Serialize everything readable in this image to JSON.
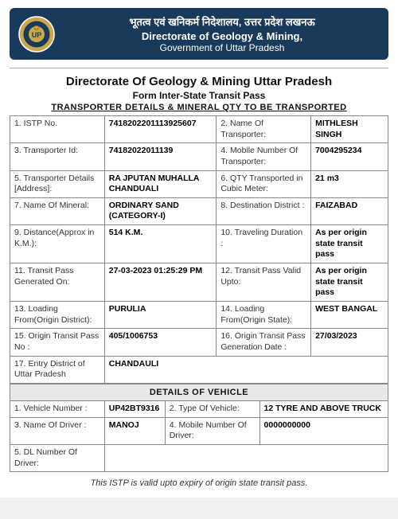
{
  "header": {
    "hindi_title": "भूतत्व एवं खनिकर्म निदेशालय, उत्तर प्रदेश लखनऊ",
    "eng_line1": "Directorate of Geology & Mining,",
    "eng_line2": "Government of Uttar Pradesh"
  },
  "main_title": "Directorate Of Geology & Mining Uttar Pradesh",
  "form_title": "Form Inter-State Transit Pass",
  "section_heading": "Transporter Details & Mineral QTY to be Transported",
  "rows": [
    {
      "col1_label": "1. ISTP No.",
      "col1_value": "7418202201113925607",
      "col2_label": "2. Name Of Transporter:",
      "col2_value": "MITHLESH SINGH"
    },
    {
      "col1_label": "3. Transporter Id:",
      "col1_value": "74182022011139",
      "col2_label": "4. Mobile Number Of Transporter:",
      "col2_value": "7004295234"
    },
    {
      "col1_label": "5. Transporter Details [Address]:",
      "col1_value": "RA JPUTAN MUHALLA CHANDUALI",
      "col2_label": "6. QTY Transported in Cubic Meter:",
      "col2_value": "21 m3"
    },
    {
      "col1_label": "7. Name Of Mineral:",
      "col1_value": "ORDINARY SAND (CATEGORY-I)",
      "col2_label": "8. Destination District :",
      "col2_value": "FAIZABAD"
    },
    {
      "col1_label": "9. Distance(Approx in K.M.):",
      "col1_value": "514 K.M.",
      "col2_label": "10. Traveling Duration :",
      "col2_value": "As per origin state transit pass"
    },
    {
      "col1_label": "11. Transit Pass Generated On:",
      "col1_value": "27-03-2023 01:25:29 PM",
      "col2_label": "12. Transit Pass Valid Upto:",
      "col2_value": "As per origin state transit pass"
    },
    {
      "col1_label": "13. Loading From(Origin District):",
      "col1_value": "PURULIA",
      "col2_label": "14. Loading From(Origin State):",
      "col2_value": "WEST BANGAL"
    },
    {
      "col1_label": "15. Origin Transit Pass No :",
      "col1_value": "405/1006753",
      "col2_label": "16. Origin Transit Pass Generation Date :",
      "col2_value": "27/03/2023"
    },
    {
      "col1_label": "17. Entry District of Uttar Pradesh",
      "col1_value": "CHANDAULI",
      "col2_label": "",
      "col2_value": ""
    }
  ],
  "vehicle_section": "Details Of Vehicle",
  "vehicle_rows": [
    {
      "col1_label": "1. Vehicle Number :",
      "col1_value": "UP42BT9316",
      "col2_label": "2. Type Of Vehicle:",
      "col2_value": "12 TYRE AND ABOVE TRUCK"
    },
    {
      "col1_label": "3. Name Of Driver :",
      "col1_value": "MANOJ",
      "col2_label": "4. Mobile Number Of Driver:",
      "col2_value": "0000000000"
    },
    {
      "col1_label": "5. DL Number Of Driver:",
      "col1_value": "",
      "col2_label": "",
      "col2_value": ""
    }
  ],
  "footer_note": "This ISTP is valid upto expiry of origin state transit pass."
}
